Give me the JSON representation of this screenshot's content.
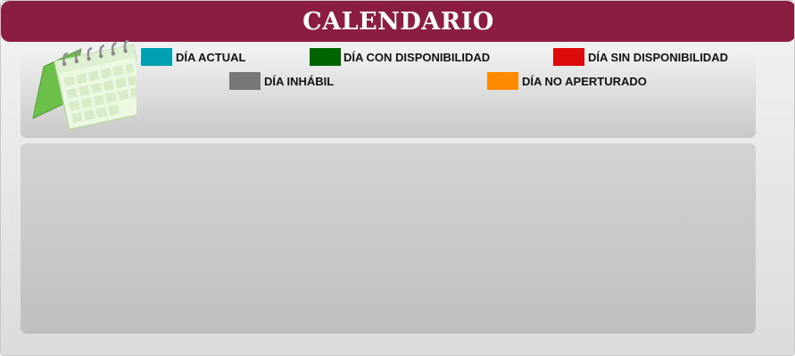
{
  "window": {
    "title": "CALENDARIO"
  },
  "legend": {
    "items": [
      {
        "label": "DÍA ACTUAL",
        "color": "#00a0b0"
      },
      {
        "label": "DÍA CON DISPONIBILIDAD",
        "color": "#006400"
      },
      {
        "label": "DÍA SIN DISPONIBILIDAD",
        "color": "#dd0c0c"
      },
      {
        "label": "DÍA INHÁBIL",
        "color": "#777777"
      },
      {
        "label": "DÍA NO APERTURADO",
        "color": "#ff8c00"
      }
    ]
  },
  "icons": {
    "calendar": "calendar-icon"
  }
}
